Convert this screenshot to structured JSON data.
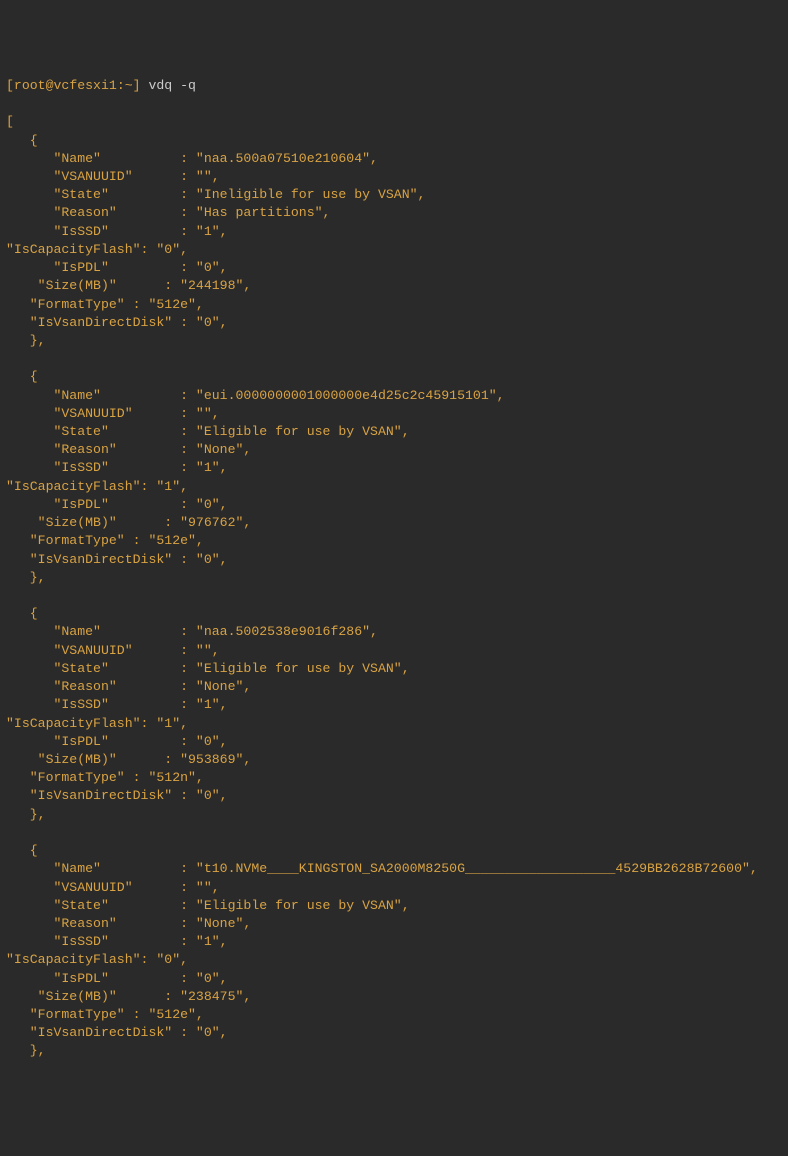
{
  "prompt": {
    "user_host": "root@vcfesxi1",
    "path": "~",
    "command": "vdq -q"
  },
  "open_bracket": "[",
  "entries": [
    {
      "Name": "naa.500a07510e210604",
      "VSANUUID": "",
      "State": "Ineligible for use by VSAN",
      "Reason": "Has partitions",
      "IsSSD": "1",
      "IsCapacityFlash": "0",
      "IsPDL": "0",
      "Size(MB)": "244198",
      "FormatType": "512e",
      "IsVsanDirectDisk": "0"
    },
    {
      "Name": "eui.0000000001000000e4d25c2c45915101",
      "VSANUUID": "",
      "State": "Eligible for use by VSAN",
      "Reason": "None",
      "IsSSD": "1",
      "IsCapacityFlash": "1",
      "IsPDL": "0",
      "Size(MB)": "976762",
      "FormatType": "512e",
      "IsVsanDirectDisk": "0"
    },
    {
      "Name": "naa.5002538e9016f286",
      "VSANUUID": "",
      "State": "Eligible for use by VSAN",
      "Reason": "None",
      "IsSSD": "1",
      "IsCapacityFlash": "1",
      "IsPDL": "0",
      "Size(MB)": "953869",
      "FormatType": "512n",
      "IsVsanDirectDisk": "0"
    },
    {
      "Name": "t10.NVMe____KINGSTON_SA2000M8250G___________________4529BB2628B72600",
      "VSANUUID": "",
      "State": "Eligible for use by VSAN",
      "Reason": "None",
      "IsSSD": "1",
      "IsCapacityFlash": "0",
      "IsPDL": "0",
      "Size(MB)": "238475",
      "FormatType": "512e",
      "IsVsanDirectDisk": "0"
    }
  ]
}
